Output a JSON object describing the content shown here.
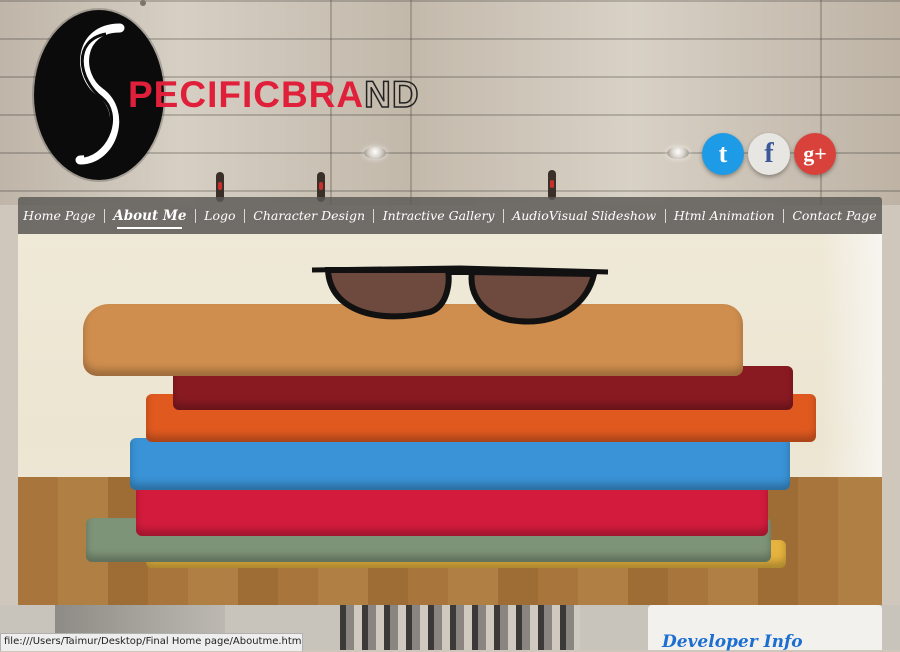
{
  "brand": {
    "name_red": "PECIFICBRA",
    "name_outline": "ND"
  },
  "social": {
    "twitter": "t",
    "facebook": "f",
    "googleplus": "g+"
  },
  "nav": {
    "items": [
      "Home Page",
      "About Me",
      "Logo",
      "Character Design",
      "Intractive Gallery",
      "AudioVisual Slideshow",
      "Html Animation",
      "Contact Page"
    ],
    "active_index": 1
  },
  "lower": {
    "panel_title": "Developer Info"
  },
  "status_bar": {
    "url": "file:///Users/Taimur/Desktop/Final Home page/Aboutme.html"
  },
  "colors": {
    "brand_red": "#e0203a",
    "twitter": "#1e9be6",
    "googleplus": "#d9423a",
    "facebook": "#3b5998"
  }
}
